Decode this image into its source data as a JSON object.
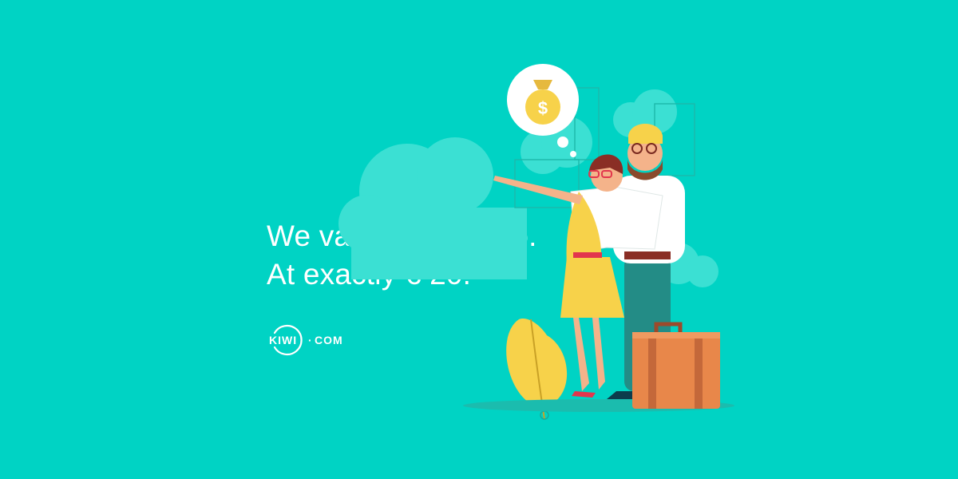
{
  "headline": {
    "line1": "We value friendship.",
    "line2": "At exactly € 20."
  },
  "logo": {
    "text_left": "KIWI",
    "text_right": "COM",
    "separator": "·"
  },
  "illustration": {
    "thought_icon": "money-bag-icon",
    "symbol": "$"
  },
  "colors": {
    "background": "#00d3c4",
    "text": "#ffffff",
    "accent_yellow": "#f7d24a",
    "suitcase": "#e8874a"
  }
}
